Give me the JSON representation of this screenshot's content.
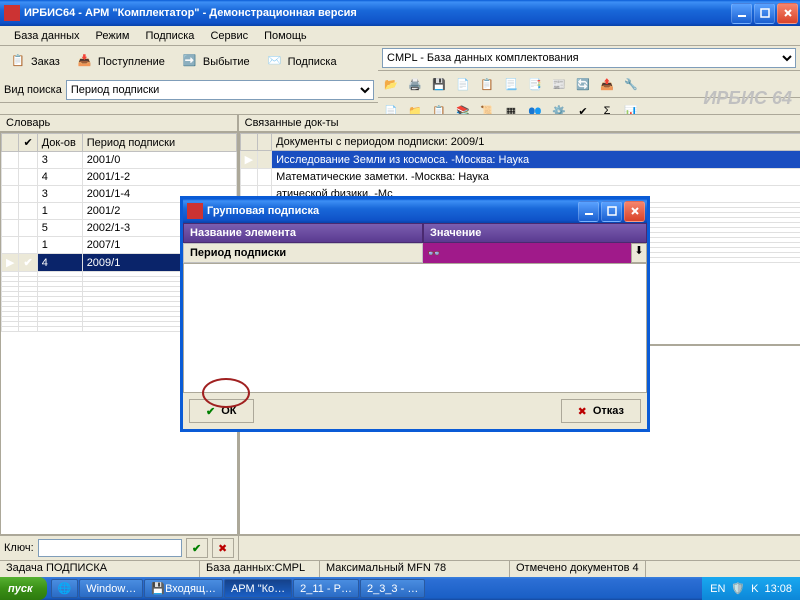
{
  "window": {
    "title": "ИРБИС64 - АРМ \"Комплектатор\" - Демонстрационная версия"
  },
  "menu": [
    "База данных",
    "Режим",
    "Подписка",
    "Сервис",
    "Помощь"
  ],
  "db_select": "CMPL - База данных комплектования",
  "big_buttons": {
    "order": "Заказ",
    "receipt": "Поступление",
    "disposal": "Выбытие",
    "subscription": "Подписка"
  },
  "view_search_label": "Вид поиска",
  "view_search_value": "Период подписки",
  "brand": "ИРБИС 64",
  "left_panel": {
    "header": "Словарь",
    "columns": {
      "check": "✔",
      "docs": "Док-ов",
      "period": "Период подписки"
    },
    "rows": [
      {
        "docs": "3",
        "period": "2001/0"
      },
      {
        "docs": "4",
        "period": "2001/1-2"
      },
      {
        "docs": "3",
        "period": "2001/1-4"
      },
      {
        "docs": "1",
        "period": "2001/2"
      },
      {
        "docs": "5",
        "period": "2002/1-3"
      },
      {
        "docs": "1",
        "period": "2007/1"
      },
      {
        "docs": "4",
        "period": "2009/1",
        "selected": true,
        "checked": true
      }
    ],
    "key_label": "Ключ:"
  },
  "right_panel": {
    "header": "Связанные док-ты",
    "rows": [
      "Документы с периодом подписки: 2009/1",
      "Исследование Земли из космоса. -Москва: Наука",
      "Математические заметки. -Москва: Наука",
      "атической физики. -Мс"
    ]
  },
  "status": {
    "task": "Задача ПОДПИСКА",
    "db": "База данных:CMPL",
    "mfn": "Максимальный MFN 78",
    "marked": "Отмечено документов 4"
  },
  "taskbar": {
    "start": "пуск",
    "items": [
      "Window…",
      "Входящ…",
      "АРМ \"Ко…",
      "2_11 - P…",
      "2_3_3 - …"
    ],
    "lang": "EN",
    "time": "13:08"
  },
  "dialog": {
    "title": "Групповая подписка",
    "col_name": "Название элемента",
    "col_value": "Значение",
    "row_label": "Период подписки",
    "ok": "ОК",
    "cancel": "Отказ"
  }
}
